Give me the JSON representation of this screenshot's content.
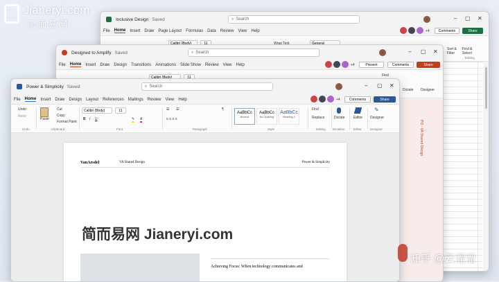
{
  "watermark_top": {
    "logo_text": "Jianeryi.com",
    "sub_text": "简而易网"
  },
  "watermark_center": "简而易网 Jianeryi.com",
  "watermark_bottom": "知乎 @云溜溜",
  "excel": {
    "title": "Inclusive Design",
    "saved": "Saved",
    "search": "Search",
    "menu": [
      "File",
      "Home",
      "Insert",
      "Draw",
      "Page Layout",
      "Formulas",
      "Data",
      "Review",
      "View",
      "Help"
    ],
    "comments": "Comments",
    "share": "Share",
    "avatar_count": "+4",
    "font": "Calibri (Body)",
    "size": "11",
    "wrap": "Wrap Text",
    "format": "General",
    "sort_filter": "Sort & Filter",
    "find_select": "Find & Select",
    "editing": "Editing"
  },
  "ppt": {
    "title": "Designed to Amplify",
    "saved": "Saved",
    "search": "Search",
    "menu": [
      "File",
      "Home",
      "Insert",
      "Draw",
      "Design",
      "Transitions",
      "Animations",
      "Slide Show",
      "Review",
      "View",
      "Help"
    ],
    "present": "Present",
    "comments": "Comments",
    "share": "Share",
    "avatar_count": "+4",
    "font": "Calibri (Body)",
    "size": "11",
    "find": "Find",
    "dictate": "Dictate",
    "designer": "Designer",
    "side_text": "PO - VA Shared Design"
  },
  "word": {
    "title": "Power & Simplicity",
    "saved": "Saved",
    "search": "Search",
    "menu": [
      "File",
      "Home",
      "Insert",
      "Draw",
      "Design",
      "Layout",
      "References",
      "Mailings",
      "Review",
      "View",
      "Help"
    ],
    "comments": "Comments",
    "share": "Share",
    "avatar_count": "+4",
    "font": "Calibri (Body)",
    "size": "11",
    "undo": "Undo",
    "redo": "Redo",
    "paste": "Paste",
    "cut": "Cut",
    "copy": "Copy",
    "format_painter": "Format Paint",
    "styles": [
      {
        "sample": "AaBbCc",
        "name": "Normal"
      },
      {
        "sample": "AaBbCc",
        "name": "No Spacing"
      },
      {
        "sample": "AaBbCc",
        "name": "Heading 1"
      }
    ],
    "find": "Find",
    "replace": "Replace",
    "dictate": "Dictate",
    "editor": "Editor",
    "designer": "Designer",
    "groups": [
      "Undo",
      "Clipboard",
      "Font",
      "Paragraph",
      "Style",
      "Editing",
      "Dictation",
      "Editor",
      "Designer"
    ],
    "doc_logo": "VanArsdel",
    "doc_header_center": "VA Shared Design",
    "doc_header_right": "Power & Simplicity",
    "doc_body_heading": "Achieving Focus: When technology communicates and"
  }
}
